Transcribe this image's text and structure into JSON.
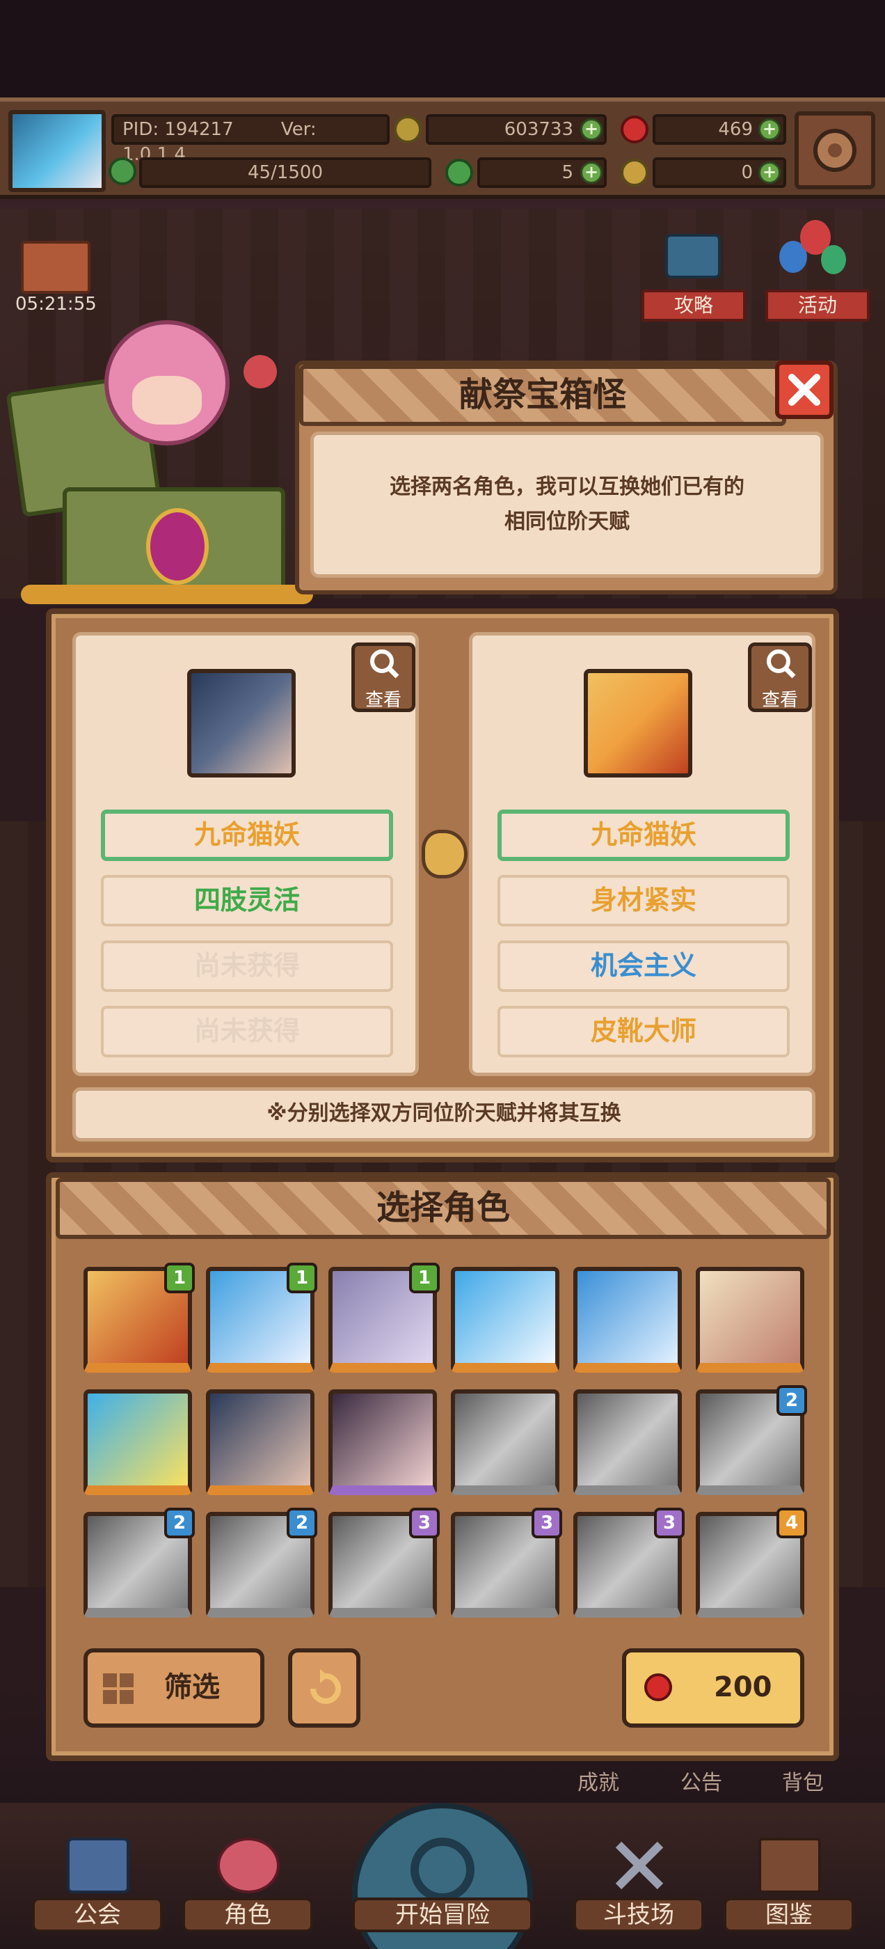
{
  "top_bar": {
    "pid": "PID: 194217",
    "version": "Ver: 1.0.1.4",
    "gold": "603733",
    "gems": "469",
    "exp": "45/1500",
    "clover": "5",
    "keys": "0"
  },
  "event_timer": "05:21:55",
  "side_buttons": {
    "guide": "攻略",
    "event": "活动"
  },
  "dialog": {
    "title": "献祭宝箱怪",
    "description_line1": "选择两名角色，我可以互换她们已有的",
    "description_line2": "相同位阶天赋"
  },
  "swap_panel": {
    "view_label": "查看",
    "left_talents": [
      "九命猫妖",
      "四肢灵活",
      "尚未获得",
      "尚未获得"
    ],
    "right_talents": [
      "九命猫妖",
      "身材紧实",
      "机会主义",
      "皮靴大师"
    ],
    "hint": "※分别选择双方同位阶天赋并将其互换"
  },
  "talent_colors": {
    "gold": "#e8a030",
    "green": "#3eaa4a",
    "blue": "#3a8ed0",
    "locked": "#e6d2c0",
    "selected_border": "#5bb573"
  },
  "select_panel": {
    "title": "选择角色",
    "characters": [
      {
        "name": "blonde-girl",
        "badge": "1",
        "badge_color": "#5aaa3a",
        "greyed": false
      },
      {
        "name": "blue-hair-girl",
        "badge": "1",
        "badge_color": "#5aaa3a",
        "greyed": false
      },
      {
        "name": "silver-hair-girl",
        "badge": "1",
        "badge_color": "#5aaa3a",
        "greyed": false
      },
      {
        "name": "blue-hair-girl-2",
        "badge": "",
        "badge_color": "",
        "greyed": false
      },
      {
        "name": "blue-hair-girl-3",
        "badge": "",
        "badge_color": "",
        "greyed": false
      },
      {
        "name": "blonde-girl-2",
        "badge": "",
        "badge_color": "",
        "greyed": false
      },
      {
        "name": "blue-hair-girl-4",
        "badge": "",
        "badge_color": "",
        "greyed": false
      },
      {
        "name": "cat-girl",
        "badge": "",
        "badge_color": "",
        "greyed": false
      },
      {
        "name": "black-hair-girl",
        "badge": "",
        "badge_color": "",
        "greyed": false
      },
      {
        "name": "grey-girl-1",
        "badge": "",
        "badge_color": "",
        "greyed": true
      },
      {
        "name": "grey-girl-2",
        "badge": "",
        "badge_color": "",
        "greyed": true
      },
      {
        "name": "grey-girl-3",
        "badge": "2",
        "badge_color": "#3a8ed0",
        "greyed": true
      },
      {
        "name": "grey-girl-4",
        "badge": "2",
        "badge_color": "#3a8ed0",
        "greyed": true
      },
      {
        "name": "grey-girl-5",
        "badge": "2",
        "badge_color": "#3a8ed0",
        "greyed": true
      },
      {
        "name": "grey-girl-6",
        "badge": "3",
        "badge_color": "#a070c8",
        "greyed": true
      },
      {
        "name": "grey-girl-7",
        "badge": "3",
        "badge_color": "#a070c8",
        "greyed": true
      },
      {
        "name": "grey-girl-8",
        "badge": "3",
        "badge_color": "#a070c8",
        "greyed": true
      },
      {
        "name": "grey-girl-9",
        "badge": "4",
        "badge_color": "#e89a30",
        "greyed": true
      }
    ],
    "filter_label": "筛选",
    "cost": "200"
  },
  "behind_labels": {
    "achievements": "成就",
    "notice": "公告",
    "bag": "背包"
  },
  "bottom_nav": [
    "公会",
    "角色",
    "开始冒险",
    "斗技场",
    "图鉴"
  ]
}
